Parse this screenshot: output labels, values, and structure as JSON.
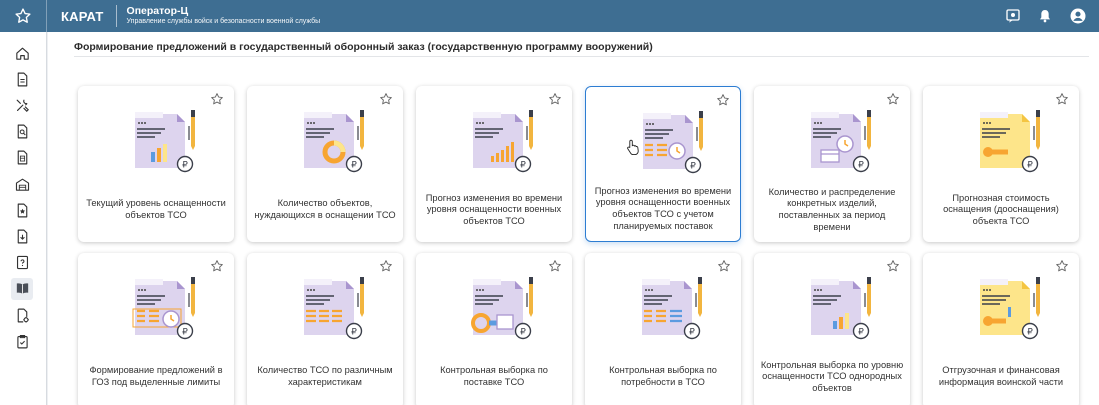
{
  "header": {
    "brand": "КАРАТ",
    "app_title": "Оператор-Ц",
    "app_subtitle": "Управление службы войск и безопасности военной службы"
  },
  "sidebar": {
    "items": [
      {
        "icon": "home-icon"
      },
      {
        "icon": "document-icon"
      },
      {
        "icon": "tools-icon"
      },
      {
        "icon": "search-document-icon"
      },
      {
        "icon": "calculator-document-icon"
      },
      {
        "icon": "warehouse-icon"
      },
      {
        "icon": "star-document-icon"
      },
      {
        "icon": "download-document-icon"
      },
      {
        "icon": "help-document-icon"
      },
      {
        "icon": "book-icon",
        "active": true
      },
      {
        "icon": "document-settings-icon"
      },
      {
        "icon": "clipboard-icon"
      }
    ]
  },
  "page": {
    "title": "Формирование предложений в государственный оборонный заказ (государственную программу вооружений)"
  },
  "cards": [
    {
      "label": "Текущий уровень оснащенности объектов ТСО",
      "art": "bars"
    },
    {
      "label": "Количество объектов, нуждающихся в оснащении ТСО",
      "art": "donut"
    },
    {
      "label": "Прогноз изменения во времени уровня оснащенности военных объектов ТСО",
      "art": "growth"
    },
    {
      "label": "Прогноз изменения во времени уровня оснащенности военных объектов ТСО с учетом планируемых поставок",
      "art": "list-clock",
      "selected": true
    },
    {
      "label": "Количество и распределение конкретных изделий, поставленных за период времени",
      "art": "box-clock"
    },
    {
      "label": "Прогнозная стоимость оснащения (дооснащения) объекта ТСО",
      "art": "doc-yellow"
    },
    {
      "label": "Формирование предложений в ГОЗ под выделенные лимиты",
      "art": "list-clock-bold"
    },
    {
      "label": "Количество ТСО по различным характеристикам",
      "art": "list-grid"
    },
    {
      "label": "Контрольная выборка по поставке ТСО",
      "art": "box-ring"
    },
    {
      "label": "Контрольная выборка по потребности в ТСО",
      "art": "list-only"
    },
    {
      "label": "Контрольная выборка по уровню оснащенности ТСО однородных объектов",
      "art": "bars-small"
    },
    {
      "label": "Отгрузочная и финансовая информация воинской части",
      "art": "doc-yellow-bars"
    }
  ],
  "colors": {
    "header_bg": "#3e6e92",
    "accent": "#2d7dd2",
    "illustration_purple": "#ddd4ee",
    "illustration_purple_dark": "#a995cf",
    "illustration_orange": "#f7a531",
    "illustration_yellow": "#fde58a",
    "illustration_blue": "#5b9be0"
  }
}
